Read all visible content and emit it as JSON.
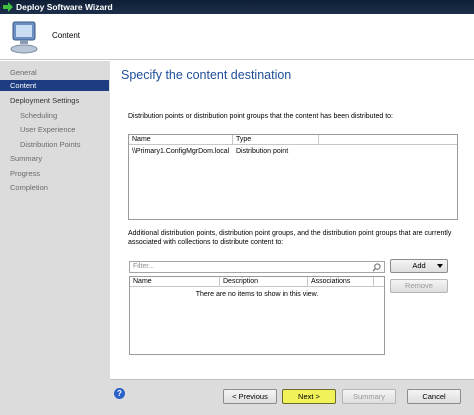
{
  "window": {
    "title": "Deploy Software Wizard"
  },
  "header": {
    "step_name": "Content"
  },
  "sidebar": {
    "items": [
      {
        "label": "General"
      },
      {
        "label": "Content"
      },
      {
        "label": "Deployment Settings"
      },
      {
        "label": "Scheduling"
      },
      {
        "label": "User Experience"
      },
      {
        "label": "Distribution Points"
      },
      {
        "label": "Summary"
      },
      {
        "label": "Progress"
      },
      {
        "label": "Completion"
      }
    ],
    "active_index": 1
  },
  "main": {
    "heading": "Specify the content destination",
    "distributed_description": "Distribution points or distribution point groups that the content has been distributed to:",
    "distributed_table": {
      "columns": [
        "Name",
        "Type"
      ],
      "rows": [
        [
          "\\\\Primary1.ConfigMgrDom.local",
          "Distribution point"
        ]
      ]
    },
    "additional_description": "Additional distribution points, distribution point groups, and the distribution point groups that are currently associated with collections to distribute content to:",
    "filter_placeholder": "Filter...",
    "add_button": "Add",
    "remove_button": "Remove",
    "additional_table": {
      "columns": [
        "Name",
        "Description",
        "Associations"
      ],
      "empty_message": "There are no items to show in this view."
    }
  },
  "footer": {
    "help": "?",
    "previous": "< Previous",
    "next": "Next >",
    "summary": "Summary",
    "cancel": "Cancel"
  },
  "colors": {
    "heading": "#1f4f9a",
    "active_nav": "#1e3c82",
    "next_highlight": "#f2f25a"
  }
}
